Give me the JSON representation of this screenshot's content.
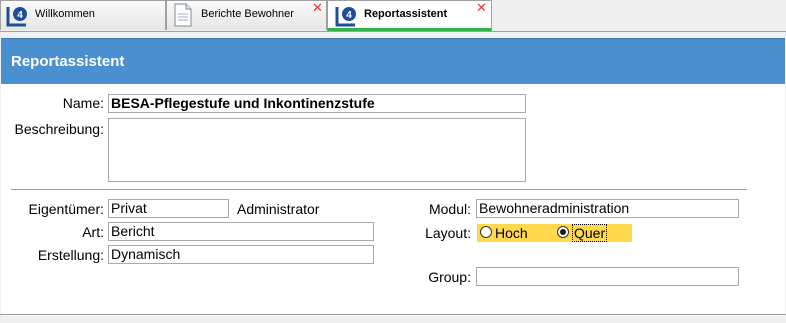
{
  "tabs": [
    {
      "label": "Willkommen",
      "icon": "app-logo-icon",
      "closable": false
    },
    {
      "label": "Berichte Bewohner",
      "icon": "document-icon",
      "closable": true
    },
    {
      "label": "Reportassistent",
      "icon": "app-logo-icon",
      "closable": true,
      "active": true
    }
  ],
  "close_glyph": "✕",
  "header": {
    "title": "Reportassistent"
  },
  "form": {
    "name_label": "Name:",
    "name_value": "BESA-Pflegestufe und Inkontinenzstufe",
    "beschreibung_label": "Beschreibung:",
    "beschreibung_value": "",
    "eigentuemer_label": "Eigentümer:",
    "eigentuemer_value": "Privat",
    "eigentuemer_user": "Administrator",
    "art_label": "Art:",
    "art_value": "Bericht",
    "erstellung_label": "Erstellung:",
    "erstellung_value": "Dynamisch",
    "modul_label": "Modul:",
    "modul_value": "Bewohneradministration",
    "layout_label": "Layout:",
    "layout_options": [
      "Hoch",
      "Quer"
    ],
    "layout_selected": "Quer",
    "group_label": "Group:",
    "group_value": ""
  },
  "colors": {
    "header_bg": "#4a8fd0",
    "highlight": "#ffd84d",
    "active_tab_underline": "#2fb34a",
    "close": "#e53935"
  }
}
